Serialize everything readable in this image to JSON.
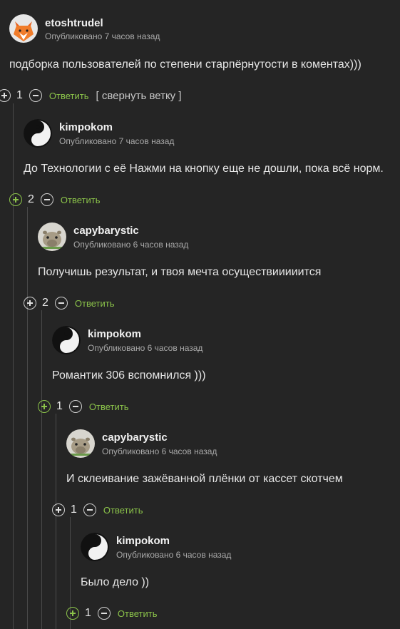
{
  "comments": [
    {
      "username": "etoshtrudel",
      "meta": "Опубликовано 7 часов назад",
      "text": "подборка пользователей по степени старпёрнутости в коментах)))",
      "rating": "1",
      "reply_label": "Ответить",
      "collapse_label": "[ свернуть ветку ]",
      "avatar": "fox-avatar"
    },
    {
      "username": "kimpokom",
      "meta": "Опубликовано 7 часов назад",
      "text": "До Технологии с её Нажми на кнопку еще не дошли, пока всё норм.",
      "rating": "2",
      "reply_label": "Ответить",
      "avatar": "yinyang-avatar"
    },
    {
      "username": "capybarystic",
      "meta": "Опубликовано 6 часов назад",
      "text": "Получишь результат, и твоя мечта осуществииииится",
      "rating": "2",
      "reply_label": "Ответить",
      "avatar": "capybara-avatar"
    },
    {
      "username": "kimpokom",
      "meta": "Опубликовано 6 часов назад",
      "text": "Романтик 306 вспомнился )))",
      "rating": "1",
      "reply_label": "Ответить",
      "avatar": "yinyang-avatar"
    },
    {
      "username": "capybarystic",
      "meta": "Опубликовано 6 часов назад",
      "text": "И склеивание зажёванной плёнки от кассет скотчем",
      "rating": "1",
      "reply_label": "Ответить",
      "avatar": "capybara-avatar"
    },
    {
      "username": "kimpokom",
      "meta": "Опубликовано 6 часов назад",
      "text": "Было дело ))",
      "rating": "1",
      "reply_label": "Ответить",
      "avatar": "yinyang-avatar"
    }
  ],
  "colors": {
    "background": "#252525",
    "accent_green": "#8bc34a",
    "meta_gray": "#a9a9a9"
  }
}
